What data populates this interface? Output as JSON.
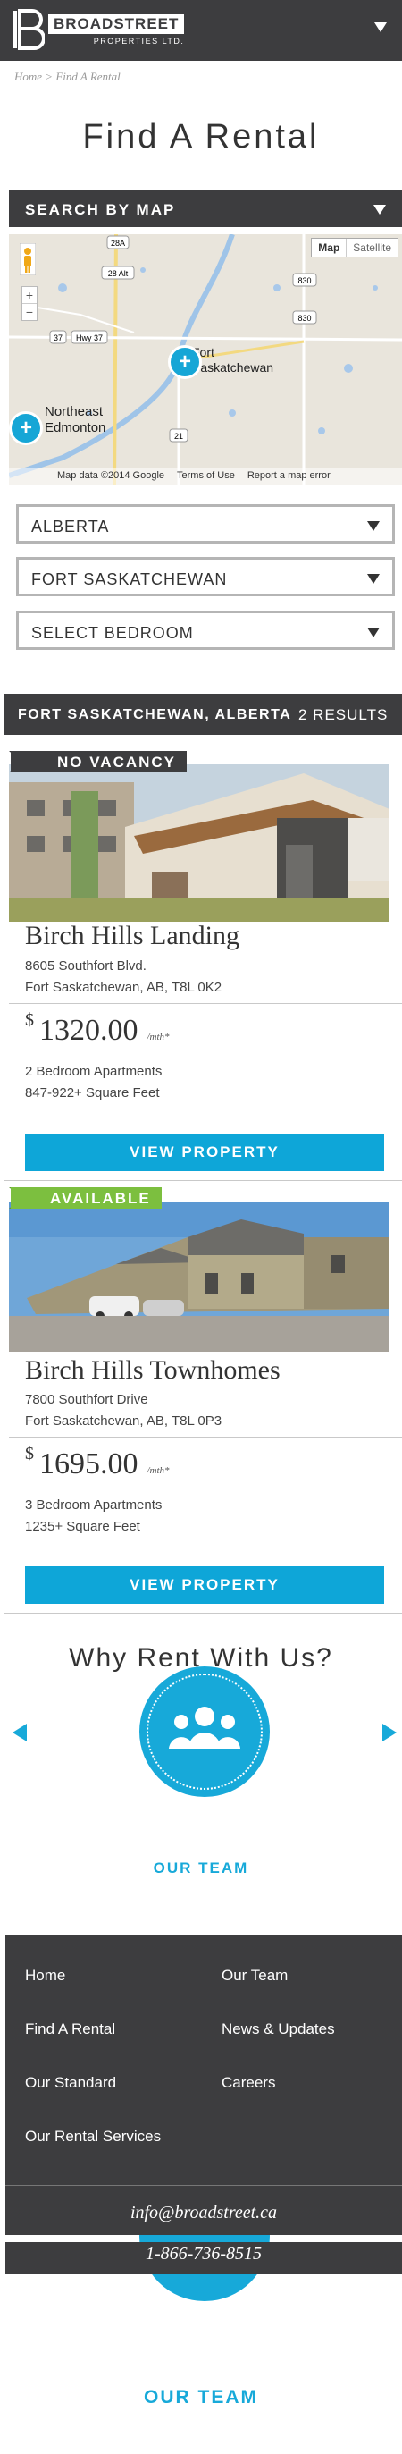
{
  "header": {
    "brand_name": "BROADSTREET",
    "brand_sub": "PROPERTIES LTD."
  },
  "breadcrumb": "Home > Find A Rental",
  "page_title": "Find A Rental",
  "map_section": {
    "label": "SEARCH BY MAP",
    "map_type_map": "Map",
    "map_type_satellite": "Satellite",
    "place_fort": "Fort Saskatchewan",
    "place_northeast": "Northeast Edmonton",
    "footer_data": "Map data ©2014 Google",
    "footer_terms": "Terms of Use",
    "footer_report": "Report a map error",
    "road_28a": "28A",
    "road_28at": "28 Alt",
    "road_37": "37",
    "road_hwy37": "Hwy 37",
    "road_830a": "830",
    "road_830b": "830",
    "road_21": "21",
    "zoom_in": "+",
    "zoom_out": "−",
    "pin_symbol": "+"
  },
  "filters": {
    "province": "ALBERTA",
    "city": "FORT SASKATCHEWAN",
    "bedroom": "SELECT BEDROOM"
  },
  "results": {
    "location": "FORT SASKATCHEWAN, ALBERTA",
    "count": "2 RESULTS"
  },
  "properties": [
    {
      "status": "NO VACANCY",
      "status_color": "#3d3d3f",
      "name": "Birch Hills Landing",
      "address1": "8605 Southfort Blvd.",
      "address2": "Fort Saskatchewan, AB, T8L 0K2",
      "currency": "$",
      "price": "1320.00",
      "unit": "/mth*",
      "beds": "2 Bedroom Apartments",
      "sqft": "847-922+ Square Feet",
      "button": "VIEW PROPERTY"
    },
    {
      "status": "AVAILABLE",
      "status_color": "#7cbf3f",
      "name": "Birch Hills Townhomes",
      "address1": "7800 Southfort Drive",
      "address2": "Fort Saskatchewan, AB, T8L 0P3",
      "currency": "$",
      "price": "1695.00",
      "unit": "/mth*",
      "beds": "3 Bedroom Apartments",
      "sqft": "1235+ Square Feet",
      "button": "VIEW PROPERTY"
    }
  ],
  "why": {
    "title": "Why Rent With Us?",
    "slide_label": "OUR TEAM",
    "slide_label_2": "OUR TEAM"
  },
  "footer": {
    "links": [
      "Home",
      "Our Team",
      "Find A Rental",
      "News & Updates",
      "Our Standard",
      "Careers",
      "Our Rental Services"
    ],
    "email": "info@broadstreet.ca",
    "phone": "1-866-736-8515"
  },
  "colors": {
    "accent": "#0ea6d8",
    "dark": "#3d3d3f",
    "available": "#7cbf3f"
  }
}
